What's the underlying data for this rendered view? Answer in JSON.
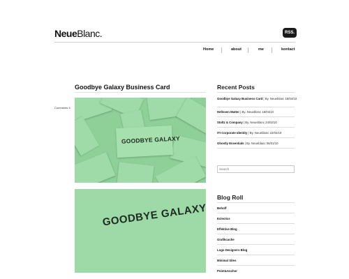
{
  "site": {
    "logo_bold": "Neue",
    "logo_rest": "Blanc.",
    "rss_label": "RSS."
  },
  "nav": {
    "items": [
      "Home",
      "about",
      "me",
      "kontact"
    ]
  },
  "post": {
    "title": "Goodbye Galaxy Business Card",
    "comments": "Comments 5",
    "card_text": "GOODBYE GALAXY",
    "photo_color": "#8fcf98"
  },
  "sidebar": {
    "recent_title": "Recent Posts",
    "recent": [
      {
        "title": "Goodbye Galaxy Business Card",
        "meta": " | By. Neueblanc 18/04/10"
      },
      {
        "title": "Helloven Matter",
        "meta": " | By. Neueblanc 18/04/10"
      },
      {
        "title": "Stoltz & Company",
        "meta": " | By. Neueblanc 24/02/10"
      },
      {
        "title": "ITI Corporate Identity",
        "meta": " | By. Neueblanc 22/02/10"
      },
      {
        "title": "Ghostly Essentials",
        "meta": " | By. Neueblanc 06/01/10"
      }
    ],
    "search_placeholder": "Search",
    "blogroll_title": "Blog Roll",
    "blogroll": [
      "Behoff",
      "Eclectics",
      "Effektive Blog",
      "Grafikcache",
      "Logo Designers Blog",
      "Minimal Sites",
      "Point&Anchor"
    ]
  }
}
